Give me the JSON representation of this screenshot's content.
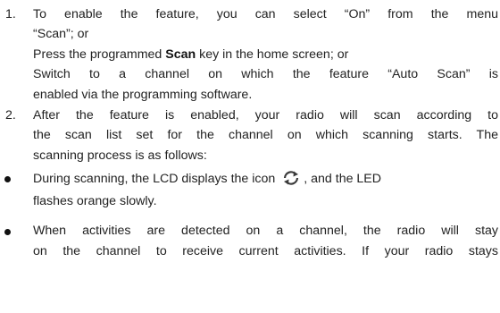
{
  "steps": [
    {
      "number": "1.",
      "lines": [
        "To enable the feature, you can select “On” from the menu",
        "“Scan”; or"
      ],
      "alt_lines": {
        "press_prefix": "Press the programmed",
        "press_key": "Scan",
        "press_suffix": "key in the home screen; or",
        "switch_line1": "Switch to a channel on which the feature “Auto Scan” is",
        "switch_line2": "enabled via the programming software."
      }
    },
    {
      "number": "2.",
      "lines": [
        "After the feature is enabled, your radio will scan according to",
        "the scan list set for the channel on which scanning starts. The",
        "scanning process is as follows:"
      ]
    }
  ],
  "bullets": [
    {
      "line1_prefix": "During scanning, the LCD displays the icon",
      "line1_suffix": ", and the LED",
      "line2": "flashes orange slowly.",
      "icon": "scan-icon"
    },
    {
      "line1": "When activities are detected on a channel, the radio will stay",
      "line2": "on the channel to receive current activities. If your radio stays"
    }
  ]
}
